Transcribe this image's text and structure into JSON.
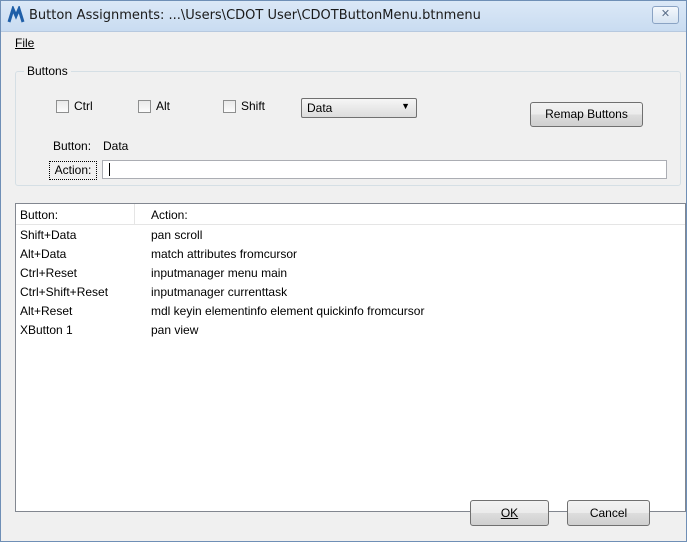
{
  "window": {
    "title": "Button Assignments: ...\\Users\\CDOT User\\CDOTButtonMenu.btnmenu",
    "close_symbol": "✕"
  },
  "menu": {
    "file_label": "File"
  },
  "buttons_group": {
    "legend": "Buttons",
    "ctrl_label": "Ctrl",
    "alt_label": "Alt",
    "shift_label": "Shift",
    "button_select_value": "Data",
    "remap_label": "Remap Buttons",
    "button_label": "Button:",
    "button_value": "Data",
    "action_label": "Action:",
    "action_value": ""
  },
  "assignments": {
    "columns": [
      "Button:",
      "Action:"
    ],
    "rows": [
      {
        "button": "Shift+Data",
        "action": "pan scroll"
      },
      {
        "button": "Alt+Data",
        "action": "match attributes fromcursor"
      },
      {
        "button": "Ctrl+Reset",
        "action": "inputmanager menu main"
      },
      {
        "button": "Ctrl+Shift+Reset",
        "action": "inputmanager currenttask"
      },
      {
        "button": "Alt+Reset",
        "action": "mdl keyin elementinfo element quickinfo fromcursor"
      },
      {
        "button": "XButton 1",
        "action": "pan view"
      }
    ]
  },
  "footer": {
    "ok_label": "OK",
    "cancel_label": "Cancel"
  },
  "colors": {
    "title_bar": "#c9dcf1",
    "dialog_bg": "#f0f0f0",
    "list_bg": "#ffffff"
  },
  "icons": {
    "app": "microstation-app-icon",
    "dropdown": "chevron-down-icon"
  }
}
